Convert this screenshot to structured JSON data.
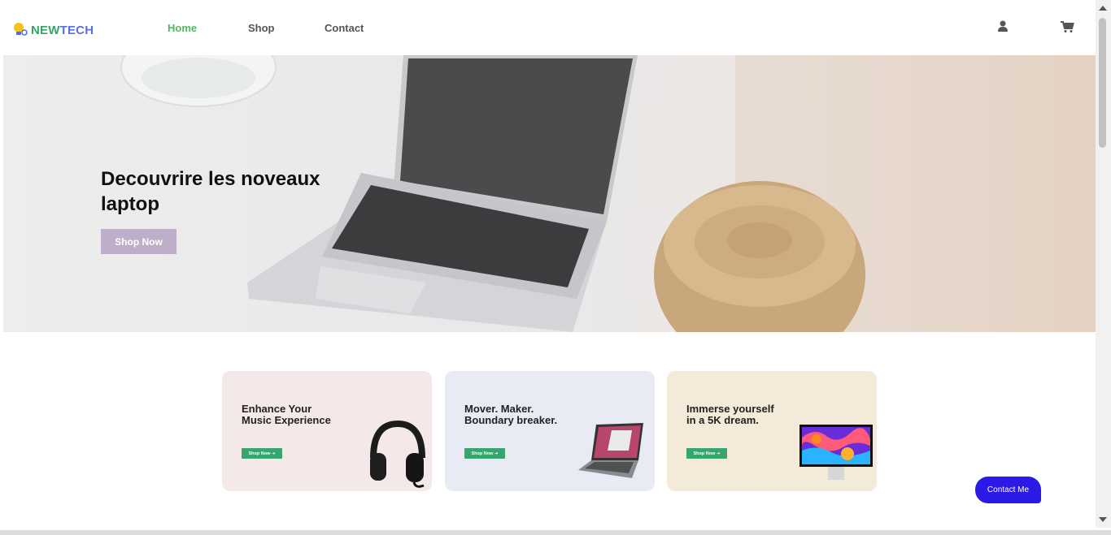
{
  "brand": {
    "part1": "NEW",
    "part2": "TECH"
  },
  "nav": {
    "items": [
      "Home",
      "Shop",
      "Contact"
    ],
    "active": "Home"
  },
  "header_icons": [
    "user-icon",
    "cart-icon"
  ],
  "hero": {
    "title": "Decouvrire les noveaux laptop",
    "button": "Shop Now"
  },
  "cards": [
    {
      "line1": "Enhance Your",
      "line2": "Music Experience",
      "button": "Shop Now ➜",
      "bg": "#f4e9e8",
      "image": "headphones"
    },
    {
      "line1": "Mover. Maker.",
      "line2": "Boundary breaker.",
      "button": "Shop Now ➜",
      "bg": "#e8ebf3",
      "image": "laptop"
    },
    {
      "line1": "Immerse yourself",
      "line2": "in a 5K dream.",
      "button": "Shop Now ➜",
      "bg": "#f3ead9",
      "image": "monitor"
    }
  ],
  "contact_button": "Contact Me",
  "colors": {
    "accent_green": "#52b85c",
    "hero_button": "#bfaec9",
    "contact": "#2b1ae6",
    "card_button": "#36a56e"
  }
}
